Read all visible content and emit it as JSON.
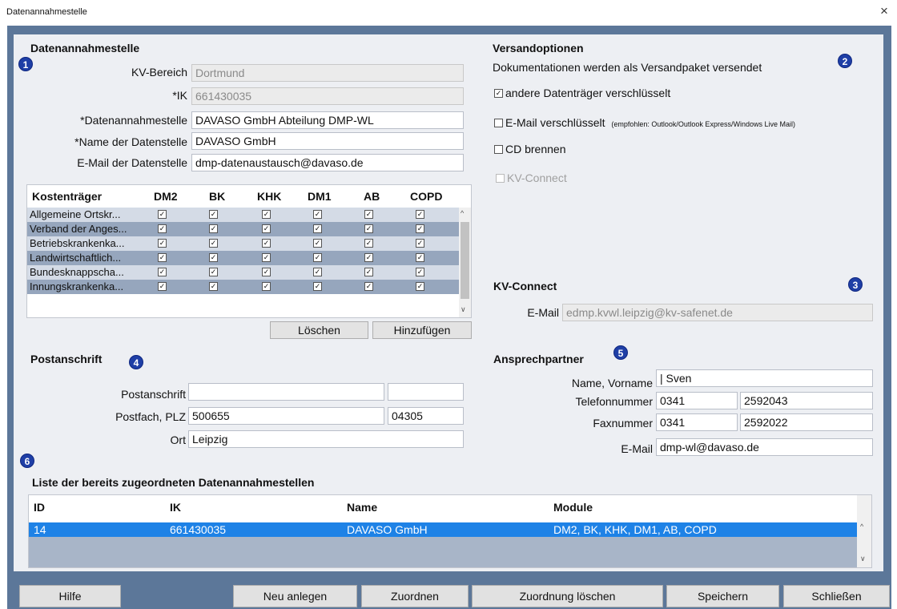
{
  "window": {
    "title": "Datenannahmestelle",
    "close": "×"
  },
  "dam": {
    "heading": "Datenannahmestelle",
    "badge": "1",
    "fields": [
      {
        "label": "KV-Bereich",
        "value": "Dortmund"
      },
      {
        "label": "*IK",
        "value": "661430035"
      },
      {
        "label": "*Datenannahmestelle",
        "value": "DAVASO GmbH Abteilung DMP-WL"
      },
      {
        "label": "*Name der Datenstelle",
        "value": "DAVASO GmbH"
      },
      {
        "label": "E-Mail der Datenstelle",
        "value": "dmp-datenaustausch@davaso.de"
      }
    ]
  },
  "grid": {
    "headers": [
      "Kostenträger",
      "DM2",
      "BK",
      "KHK",
      "DM1",
      "AB",
      "COPD"
    ],
    "rows": [
      {
        "name": "Allgemeine Ortskr...",
        "checks": [
          true,
          true,
          true,
          true,
          true,
          true
        ]
      },
      {
        "name": "Verband der Anges...",
        "checks": [
          true,
          true,
          true,
          true,
          true,
          true
        ]
      },
      {
        "name": "Betriebskrankenka...",
        "checks": [
          true,
          true,
          true,
          true,
          true,
          true
        ]
      },
      {
        "name": "Landwirtschaftlich...",
        "checks": [
          true,
          true,
          true,
          true,
          true,
          true
        ]
      },
      {
        "name": "Bundesknappscha...",
        "checks": [
          true,
          true,
          true,
          true,
          true,
          true
        ]
      },
      {
        "name": "Innungskrankenka...",
        "checks": [
          true,
          true,
          true,
          true,
          true,
          true
        ]
      }
    ],
    "delete_label": "Löschen",
    "add_label": "Hinzufügen"
  },
  "versand": {
    "heading": "Versandoptionen",
    "subtitle": "Dokumentationen werden als Versandpaket versendet",
    "badge": "2",
    "opt1": "andere Datenträger verschlüsselt",
    "opt2": "E-Mail verschlüsselt",
    "opt2_hint": "(empfohlen: Outlook/Outlook Express/Windows Live Mail)",
    "opt3": "CD brennen",
    "opt4": "KV-Connect"
  },
  "kvconnect": {
    "heading": "KV-Connect",
    "badge": "3",
    "email_label": "E-Mail",
    "email_value": "edmp.kvwl.leipzig@kv-safenet.de"
  },
  "post": {
    "heading": "Postanschrift",
    "badge": "4",
    "postanschrift_label": "Postanschrift",
    "postfach_label": "Postfach, PLZ",
    "postfach": "500655",
    "plz": "04305",
    "ort_label": "Ort",
    "ort": "Leipzig"
  },
  "contact": {
    "heading": "Ansprechpartner",
    "badge": "5",
    "name_label": "Name, Vorname",
    "name_value": "Sven",
    "tel_label": "Telefonnummer",
    "tel_pre": "0341",
    "tel_num": "2592043",
    "fax_label": "Faxnummer",
    "fax_pre": "0341",
    "fax_num": "2592022",
    "email_label": "E-Mail",
    "email_value": "dmp-wl@davaso.de"
  },
  "list": {
    "badge": "6",
    "heading": "Liste der bereits zugeordneten Datenannahmestellen",
    "headers": [
      "ID",
      "IK",
      "Name",
      "Module"
    ],
    "row": [
      "14",
      "661430035",
      "DAVASO GmbH",
      "DM2, BK, KHK, DM1, AB, COPD"
    ]
  },
  "buttons": {
    "hilfe": "Hilfe",
    "neu": "Neu anlegen",
    "zuordnen": "Zuordnen",
    "loeschen": "Zuordnung löschen",
    "speichern": "Speichern",
    "schliessen": "Schließen"
  }
}
